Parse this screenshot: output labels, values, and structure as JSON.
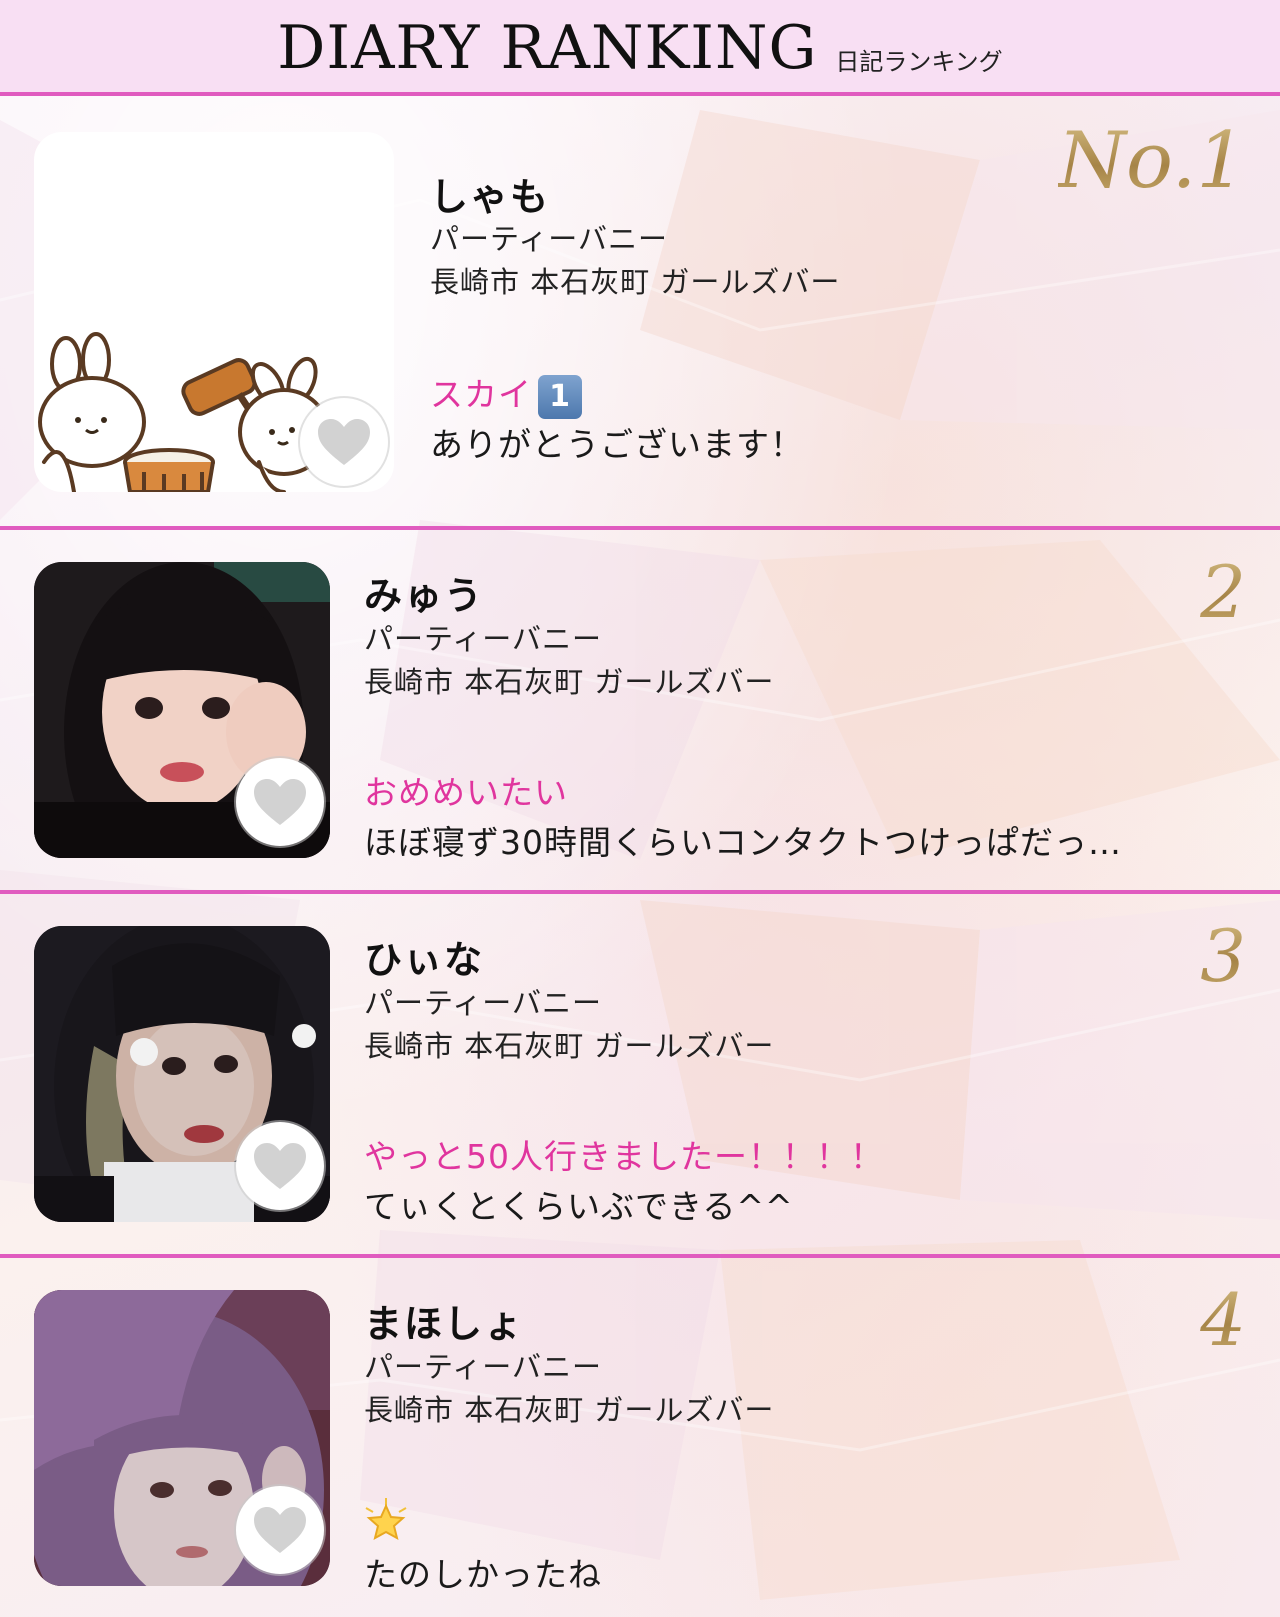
{
  "header": {
    "title_en": "DIARY RANKING",
    "title_ja": "日記ランキング"
  },
  "colors": {
    "accent_pink": "#e05bbf",
    "header_bg": "#f8dff3",
    "diary_title": "#e0359e",
    "rank_gold": "#b39a62"
  },
  "entries": [
    {
      "rank": "No.1",
      "name": "しゃも",
      "shop": "パーティーバニー",
      "area": "長崎市 本石灰町 ガールズバー",
      "diary_title": "スカイ",
      "diary_title_badge": "1",
      "diary_body": "ありがとうございます！",
      "photo": "illustration-rabbits-mochi",
      "like_icon": "heart-icon"
    },
    {
      "rank": "2",
      "name": "みゅう",
      "shop": "パーティーバニー",
      "area": "長崎市 本石灰町 ガールズバー",
      "diary_title": "おめめいたい",
      "diary_body": "ほぼ寝ず30時間くらいコンタクトつけっぱだっ…",
      "photo": "selfie-black-hair-bangs",
      "like_icon": "heart-icon"
    },
    {
      "rank": "3",
      "name": "ひぃな",
      "shop": "パーティーバニー",
      "area": "長崎市 本石灰町 ガールズバー",
      "diary_title": "やっと50人行きましたー！！！！",
      "diary_body": "てぃくとくらいぶできる^^",
      "photo": "selfie-glitter-face",
      "like_icon": "heart-icon"
    },
    {
      "rank": "4",
      "name": "まほしょ",
      "shop": "パーティーバニー",
      "area": "長崎市 本石灰町 ガールズバー",
      "diary_title_icon": "star-icon",
      "diary_body": "たのしかったね",
      "photo": "selfie-purple-hair",
      "like_icon": "heart-icon"
    }
  ]
}
